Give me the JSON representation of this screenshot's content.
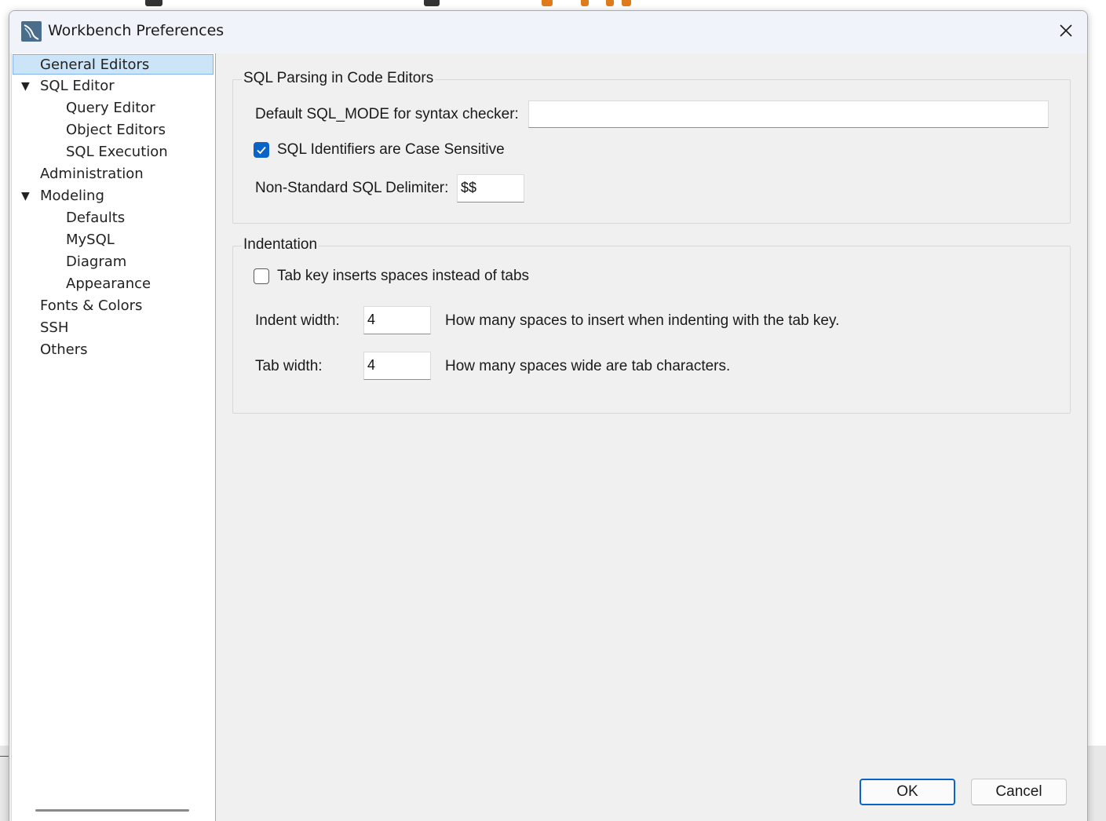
{
  "window": {
    "title": "Workbench Preferences",
    "close_icon": "close-icon",
    "app_icon": "mysql-workbench-icon"
  },
  "sidebar": {
    "items": [
      {
        "label": "General Editors",
        "level": 0,
        "selected": true
      },
      {
        "label": "SQL Editor",
        "level": 0,
        "expanded": true
      },
      {
        "label": "Query Editor",
        "level": 1
      },
      {
        "label": "Object Editors",
        "level": 1
      },
      {
        "label": "SQL Execution",
        "level": 1
      },
      {
        "label": "Administration",
        "level": 0
      },
      {
        "label": "Modeling",
        "level": 0,
        "expanded": true
      },
      {
        "label": "Defaults",
        "level": 1
      },
      {
        "label": "MySQL",
        "level": 1
      },
      {
        "label": "Diagram",
        "level": 1
      },
      {
        "label": "Appearance",
        "level": 1
      },
      {
        "label": "Fonts & Colors",
        "level": 0
      },
      {
        "label": "SSH",
        "level": 0
      },
      {
        "label": "Others",
        "level": 0
      }
    ]
  },
  "sql_parsing": {
    "group_title": "SQL Parsing in Code Editors",
    "sql_mode_label": "Default SQL_MODE for syntax checker:",
    "sql_mode_value": "",
    "case_sensitive_label": "SQL Identifiers are Case Sensitive",
    "case_sensitive_checked": true,
    "delimiter_label": "Non-Standard SQL Delimiter:",
    "delimiter_value": "$$"
  },
  "indentation": {
    "group_title": "Indentation",
    "tab_spaces_label": "Tab key inserts spaces instead of tabs",
    "tab_spaces_checked": false,
    "indent_width_label": "Indent width:",
    "indent_width_value": "4",
    "indent_width_help": "How many spaces to insert when indenting with the tab key.",
    "tab_width_label": "Tab width:",
    "tab_width_value": "4",
    "tab_width_help": "How many spaces wide are tab characters."
  },
  "buttons": {
    "ok_label": "OK",
    "cancel_label": "Cancel"
  },
  "colors": {
    "accent": "#0a64c8",
    "selection_bg": "#cce4f7",
    "selection_border": "#7eb4ea",
    "dialog_bg": "#f0f0f0"
  }
}
